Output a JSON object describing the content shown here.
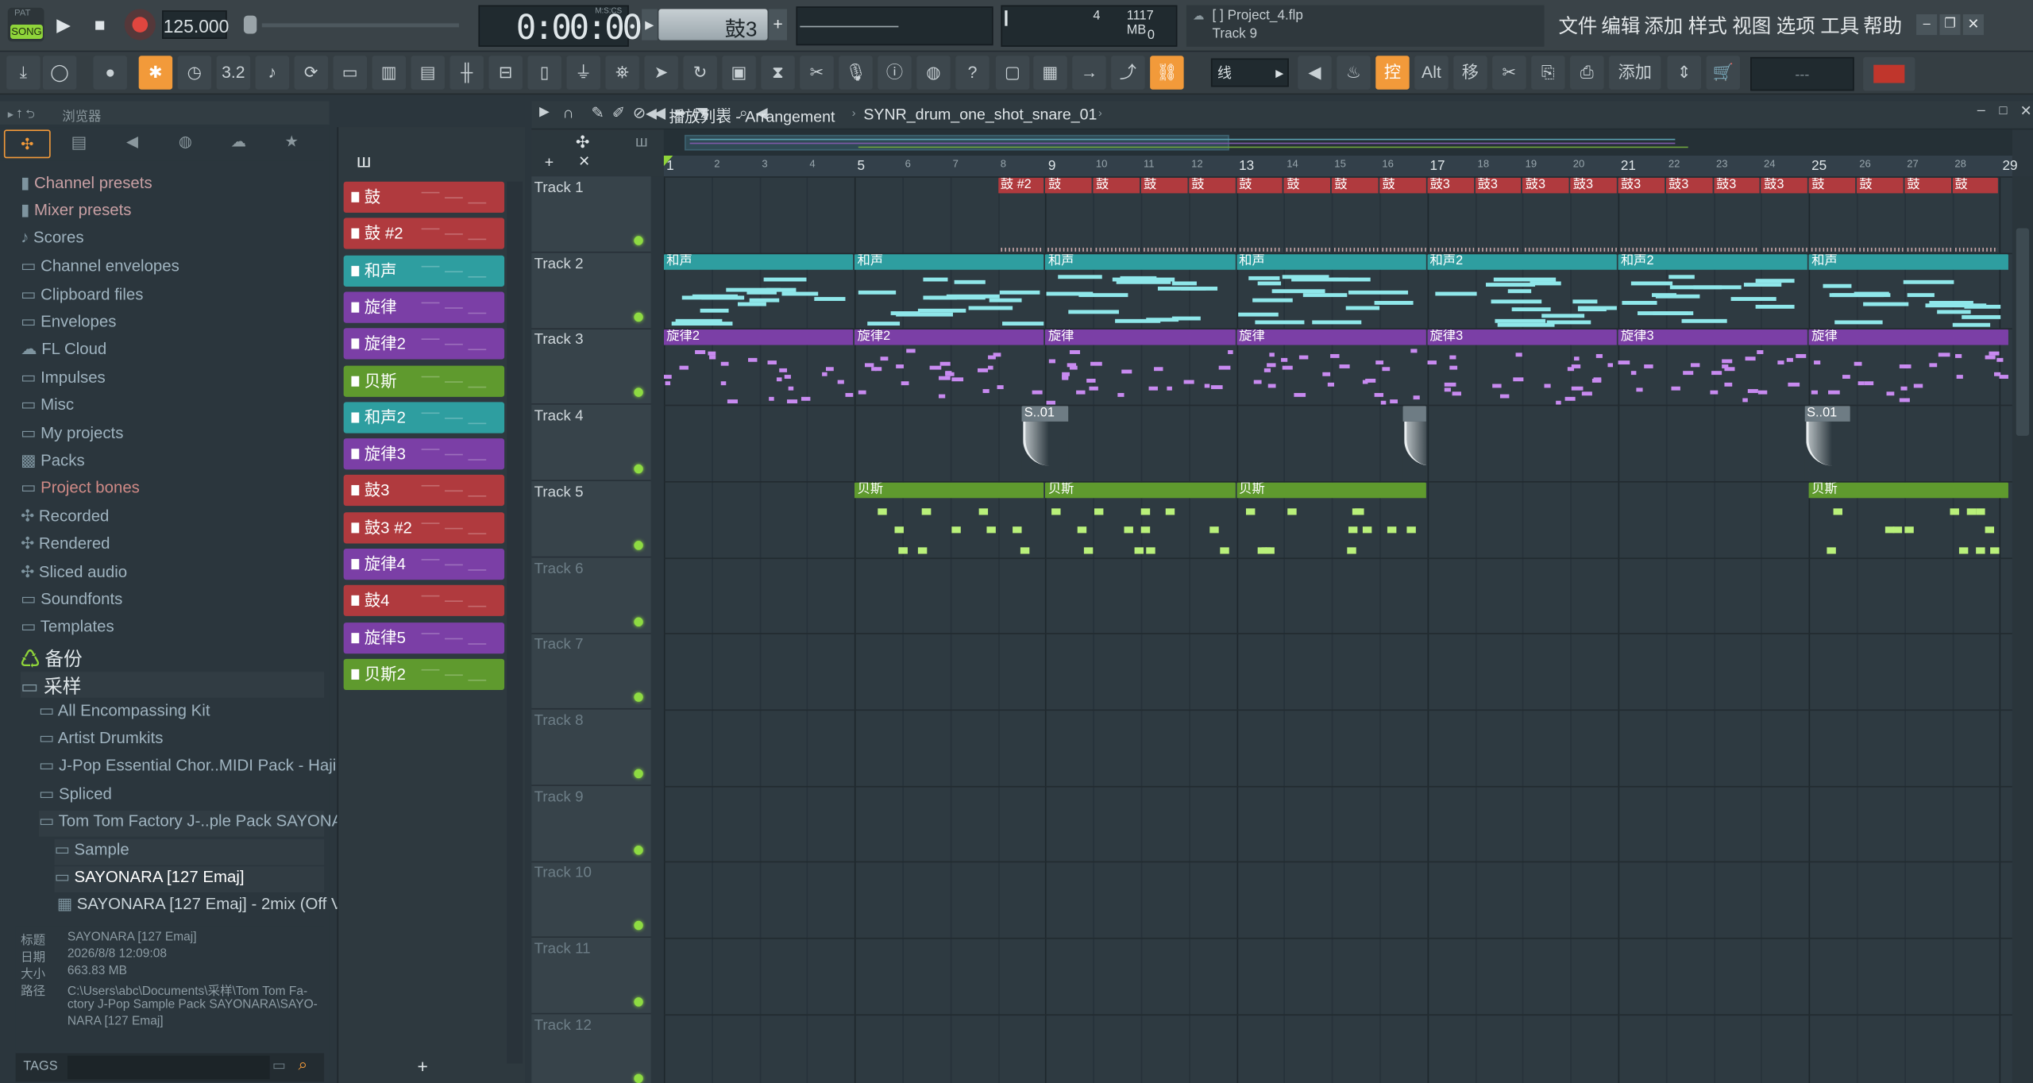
{
  "transport": {
    "song_badge": "SONG",
    "pat_label": "PAT",
    "tempo": "125.000",
    "time": "0:00:00",
    "time_label": "M:S:CS",
    "pattern": "鼓3"
  },
  "cpu": {
    "value": "4",
    "memory": "1117 MB",
    "voices": "0"
  },
  "hint": {
    "project": "[   ] Project_4.flp",
    "track": "Track 9"
  },
  "menu": [
    "文件",
    "编辑",
    "添加",
    "样式",
    "视图",
    "选项",
    "工具",
    "帮助"
  ],
  "toolbar": {
    "snap": "线",
    "ctrl_label": "控",
    "alt_label": "Alt",
    "move_label": "移",
    "add_label": "添加",
    "digits": "3.2",
    "empty_field": "---"
  },
  "browser": {
    "title": "浏览器",
    "items": [
      {
        "label": "Channel presets",
        "type": "preset"
      },
      {
        "label": "Mixer presets",
        "type": "preset"
      },
      {
        "label": "Scores",
        "type": "note"
      },
      {
        "label": "Channel envelopes",
        "type": "folder"
      },
      {
        "label": "Clipboard files",
        "type": "folder"
      },
      {
        "label": "Envelopes",
        "type": "folder"
      },
      {
        "label": "FL Cloud",
        "type": "cloud"
      },
      {
        "label": "Impulses",
        "type": "folder"
      },
      {
        "label": "Misc",
        "type": "folder"
      },
      {
        "label": "My projects",
        "type": "folder"
      },
      {
        "label": "Packs",
        "type": "pack"
      },
      {
        "label": "Project bones",
        "type": "folder"
      },
      {
        "label": "Recorded",
        "type": "plus"
      },
      {
        "label": "Rendered",
        "type": "plus"
      },
      {
        "label": "Sliced audio",
        "type": "plus"
      },
      {
        "label": "Soundfonts",
        "type": "folder"
      },
      {
        "label": "Templates",
        "type": "folder"
      },
      {
        "label": "备份",
        "type": "backup"
      },
      {
        "label": "采样",
        "type": "folder"
      },
      {
        "label": "All Encompassing Kit",
        "type": "sub"
      },
      {
        "label": "Artist Drumkits",
        "type": "sub"
      },
      {
        "label": "J-Pop Essential Chor..MIDI Pack - Hajimari",
        "type": "sub"
      },
      {
        "label": "Spliced",
        "type": "sub"
      },
      {
        "label": "Tom Tom Factory J-..ple Pack SAYONARA",
        "type": "sub"
      },
      {
        "label": "Sample",
        "type": "sub2"
      },
      {
        "label": "SAYONARA [127 Emaj]",
        "type": "sub2"
      },
      {
        "label": "SAYONARA [127 Emaj] - 2mix (Off Vocal)",
        "type": "file"
      }
    ],
    "info": {
      "labels": [
        "标题",
        "日期",
        "大小",
        "路径"
      ],
      "title": "SAYONARA [127 Emaj]",
      "date": "2026/8/8 12:09:08",
      "size": "663.83 MB",
      "path_lines": [
        "C:\\Users\\abc\\Documents\\采样\\Tom Tom Fa-",
        "ctory J-Pop Sample Pack SAYONARA\\SAYO-",
        "NARA [127 Emaj]"
      ]
    },
    "tags": "TAGS"
  },
  "channels": [
    {
      "label": "鼓",
      "color": "#b03a3e"
    },
    {
      "label": "鼓 #2",
      "color": "#b03a3e"
    },
    {
      "label": "和声",
      "color": "#2e9ea0"
    },
    {
      "label": "旋律",
      "color": "#7b3fa6"
    },
    {
      "label": "旋律2",
      "color": "#7b3fa6"
    },
    {
      "label": "贝斯",
      "color": "#5f9a2e"
    },
    {
      "label": "和声2",
      "color": "#2e9ea0"
    },
    {
      "label": "旋律3",
      "color": "#7b3fa6"
    },
    {
      "label": "鼓3",
      "color": "#b03a3e"
    },
    {
      "label": "鼓3 #2",
      "color": "#b03a3e"
    },
    {
      "label": "旋律4",
      "color": "#7b3fa6"
    },
    {
      "label": "鼓4",
      "color": "#b03a3e"
    },
    {
      "label": "旋律5",
      "color": "#7b3fa6"
    },
    {
      "label": "贝斯2",
      "color": "#5f9a2e"
    }
  ],
  "playlist": {
    "breadcrumb": "播放列表 - Arrangement",
    "sample": "SYNR_drum_one_shot_snare_01",
    "tracks": [
      "Track 1",
      "Track 2",
      "Track 3",
      "Track 4",
      "Track 5",
      "Track 6",
      "Track 7",
      "Track 8",
      "Track 9",
      "Track 10",
      "Track 11",
      "Track 12"
    ],
    "bars": [
      "1",
      "2",
      "3",
      "4",
      "5",
      "6",
      "7",
      "8",
      "9",
      "10",
      "11",
      "12",
      "13",
      "14",
      "15",
      "16",
      "17",
      "18",
      "19",
      "20",
      "21",
      "22",
      "23",
      "24",
      "25",
      "26",
      "27",
      "28",
      "29"
    ],
    "clips": [
      {
        "track": 1,
        "start": 8,
        "len": 1,
        "label": "鼓 #2",
        "color": "#b03a3e"
      },
      {
        "track": 1,
        "start": 9,
        "len": 1,
        "label": "鼓",
        "color": "#b03a3e"
      },
      {
        "track": 1,
        "start": 10,
        "len": 1,
        "label": "鼓",
        "color": "#b03a3e"
      },
      {
        "track": 1,
        "start": 11,
        "len": 1,
        "label": "鼓",
        "color": "#b03a3e"
      },
      {
        "track": 1,
        "start": 12,
        "len": 1,
        "label": "鼓",
        "color": "#b03a3e"
      },
      {
        "track": 1,
        "start": 13,
        "len": 1,
        "label": "鼓",
        "color": "#b03a3e"
      },
      {
        "track": 1,
        "start": 14,
        "len": 1,
        "label": "鼓",
        "color": "#b03a3e"
      },
      {
        "track": 1,
        "start": 15,
        "len": 1,
        "label": "鼓",
        "color": "#b03a3e"
      },
      {
        "track": 1,
        "start": 16,
        "len": 1,
        "label": "鼓",
        "color": "#b03a3e"
      },
      {
        "track": 1,
        "start": 17,
        "len": 1,
        "label": "鼓3",
        "color": "#b03a3e"
      },
      {
        "track": 1,
        "start": 18,
        "len": 1,
        "label": "鼓3",
        "color": "#b03a3e"
      },
      {
        "track": 1,
        "start": 19,
        "len": 1,
        "label": "鼓3",
        "color": "#b03a3e"
      },
      {
        "track": 1,
        "start": 20,
        "len": 1,
        "label": "鼓3",
        "color": "#b03a3e"
      },
      {
        "track": 1,
        "start": 21,
        "len": 1,
        "label": "鼓3",
        "color": "#b03a3e"
      },
      {
        "track": 1,
        "start": 22,
        "len": 1,
        "label": "鼓3",
        "color": "#b03a3e"
      },
      {
        "track": 1,
        "start": 23,
        "len": 1,
        "label": "鼓3",
        "color": "#b03a3e"
      },
      {
        "track": 1,
        "start": 24,
        "len": 1,
        "label": "鼓3",
        "color": "#b03a3e"
      },
      {
        "track": 1,
        "start": 25,
        "len": 1,
        "label": "鼓",
        "color": "#b03a3e"
      },
      {
        "track": 1,
        "start": 26,
        "len": 1,
        "label": "鼓",
        "color": "#b03a3e"
      },
      {
        "track": 1,
        "start": 27,
        "len": 1,
        "label": "鼓",
        "color": "#b03a3e"
      },
      {
        "track": 1,
        "start": 28,
        "len": 1,
        "label": "鼓",
        "color": "#b03a3e"
      },
      {
        "track": 2,
        "start": 1,
        "len": 4,
        "label": "和声",
        "color": "#2e9ea0"
      },
      {
        "track": 2,
        "start": 5,
        "len": 4,
        "label": "和声",
        "color": "#2e9ea0"
      },
      {
        "track": 2,
        "start": 9,
        "len": 4,
        "label": "和声",
        "color": "#2e9ea0"
      },
      {
        "track": 2,
        "start": 13,
        "len": 4,
        "label": "和声",
        "color": "#2e9ea0"
      },
      {
        "track": 2,
        "start": 17,
        "len": 4,
        "label": "和声2",
        "color": "#2e9ea0"
      },
      {
        "track": 2,
        "start": 21,
        "len": 4,
        "label": "和声2",
        "color": "#2e9ea0"
      },
      {
        "track": 2,
        "start": 25,
        "len": 4.2,
        "label": "和声",
        "color": "#2e9ea0"
      },
      {
        "track": 3,
        "start": 1,
        "len": 4,
        "label": "旋律2",
        "color": "#7b3fa6"
      },
      {
        "track": 3,
        "start": 5,
        "len": 4,
        "label": "旋律2",
        "color": "#7b3fa6"
      },
      {
        "track": 3,
        "start": 9,
        "len": 4,
        "label": "旋律",
        "color": "#7b3fa6"
      },
      {
        "track": 3,
        "start": 13,
        "len": 4,
        "label": "旋律",
        "color": "#7b3fa6"
      },
      {
        "track": 3,
        "start": 17,
        "len": 4,
        "label": "旋律3",
        "color": "#7b3fa6"
      },
      {
        "track": 3,
        "start": 21,
        "len": 4,
        "label": "旋律3",
        "color": "#7b3fa6"
      },
      {
        "track": 3,
        "start": 25,
        "len": 4.2,
        "label": "旋律",
        "color": "#7b3fa6"
      },
      {
        "track": 4,
        "start": 8.5,
        "len": 1,
        "label": "S..01",
        "color": "#4f5d66"
      },
      {
        "track": 4,
        "start": 16.5,
        "len": 0.5,
        "label": "",
        "color": "#4f5d66"
      },
      {
        "track": 4,
        "start": 24.9,
        "len": 1,
        "label": "S..01",
        "color": "#4f5d66"
      },
      {
        "track": 5,
        "start": 5,
        "len": 4,
        "label": "贝斯",
        "color": "#5f9a2e"
      },
      {
        "track": 5,
        "start": 9,
        "len": 4,
        "label": "贝斯",
        "color": "#5f9a2e"
      },
      {
        "track": 5,
        "start": 13,
        "len": 4,
        "label": "贝斯",
        "color": "#5f9a2e"
      },
      {
        "track": 5,
        "start": 25,
        "len": 4.2,
        "label": "贝斯",
        "color": "#5f9a2e"
      }
    ]
  }
}
